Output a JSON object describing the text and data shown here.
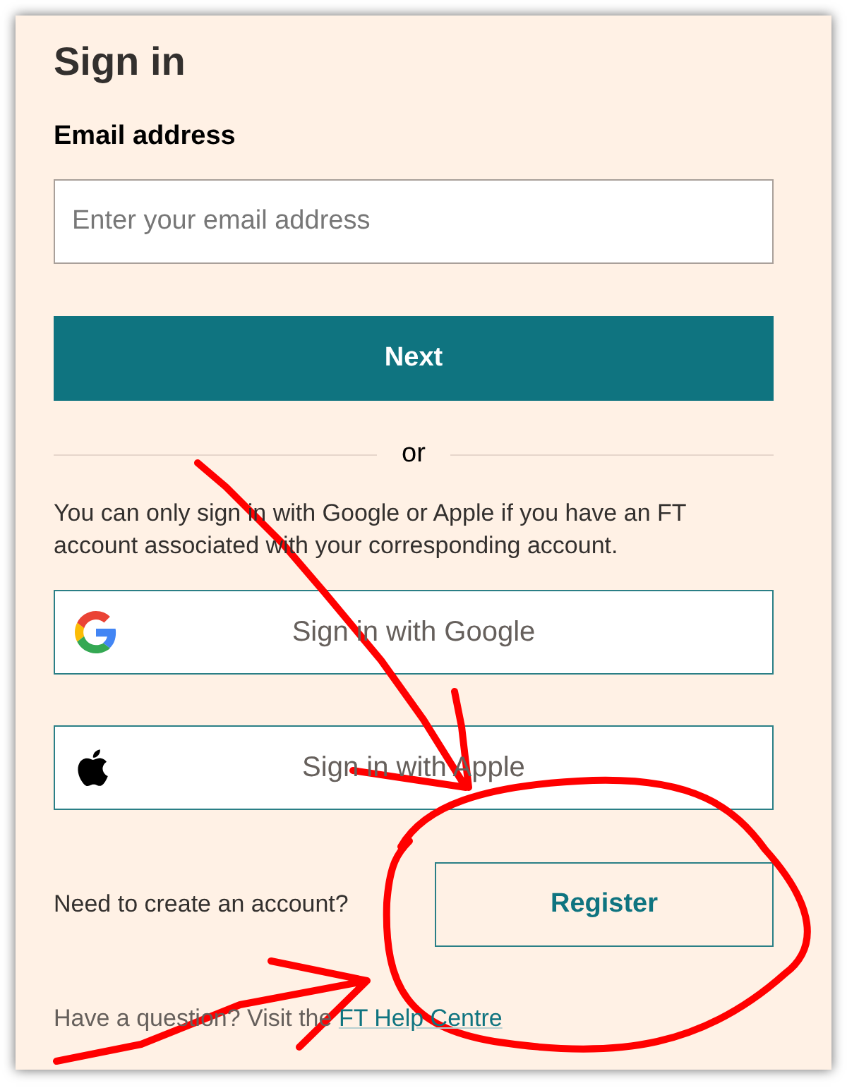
{
  "title": "Sign in",
  "email": {
    "label": "Email address",
    "placeholder": "Enter your email address"
  },
  "next_button": "Next",
  "divider": "or",
  "notice": "You can only sign in with Google or Apple if you have an FT account associated with your corresponding account.",
  "social_buttons": [
    {
      "kind": "google",
      "label": "Sign in with Google"
    },
    {
      "kind": "apple",
      "label": "Sign in with Apple"
    }
  ],
  "register": {
    "prompt": "Need to create an account?",
    "button": "Register"
  },
  "help": {
    "text": "Have a question? Visit the",
    "link": "FT Help Centre"
  }
}
